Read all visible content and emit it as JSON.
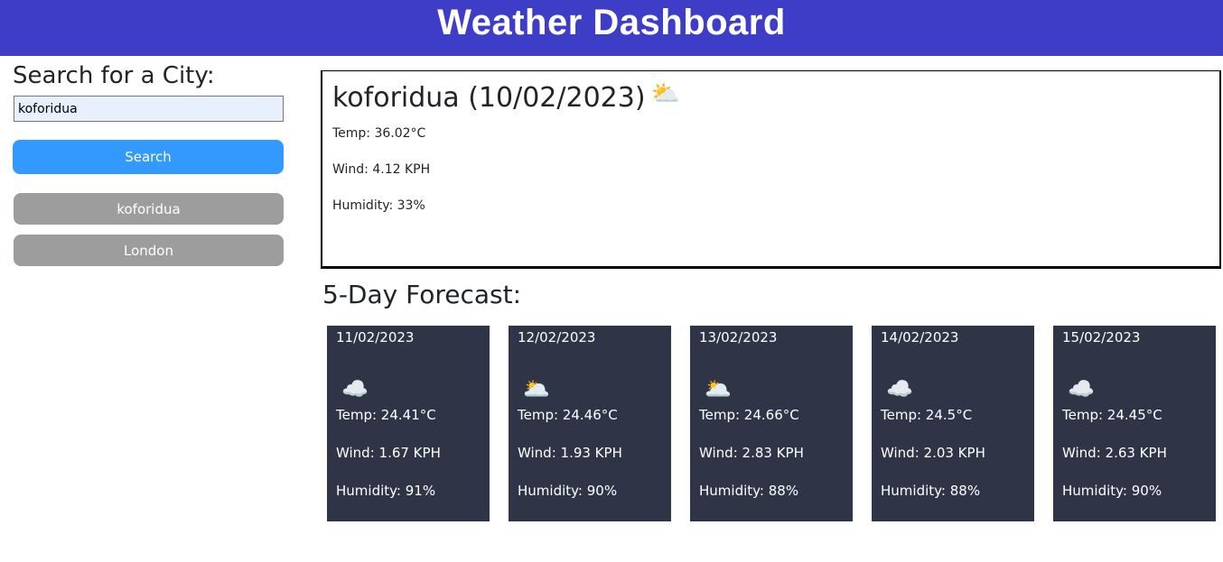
{
  "header": {
    "title": "Weather Dashboard"
  },
  "sidebar": {
    "heading": "Search for a City:",
    "search_value": "koforidua",
    "search_button": "Search",
    "history": [
      "koforidua",
      "London"
    ]
  },
  "current": {
    "title": "koforidua (10/02/2023)",
    "icon": "cloud-sun-icon",
    "temp": "Temp: 36.02°C",
    "wind": "Wind: 4.12 KPH",
    "humidity": "Humidity: 33%"
  },
  "forecast": {
    "heading": "5-Day Forecast:",
    "days": [
      {
        "date": "11/02/2023",
        "icon": "cloud-icon",
        "temp": "Temp: 24.41°C",
        "wind": "Wind: 1.67 KPH",
        "humidity": "Humidity: 91%"
      },
      {
        "date": "12/02/2023",
        "icon": "cloud-dark-icon",
        "temp": "Temp: 24.46°C",
        "wind": "Wind: 1.93 KPH",
        "humidity": "Humidity: 90%"
      },
      {
        "date": "13/02/2023",
        "icon": "cloud-dark-icon",
        "temp": "Temp: 24.66°C",
        "wind": "Wind: 2.83 KPH",
        "humidity": "Humidity: 88%"
      },
      {
        "date": "14/02/2023",
        "icon": "cloud-moon-icon",
        "temp": "Temp: 24.5°C",
        "wind": "Wind: 2.03 KPH",
        "humidity": "Humidity: 88%"
      },
      {
        "date": "15/02/2023",
        "icon": "cloud-moon-icon",
        "temp": "Temp: 24.45°C",
        "wind": "Wind: 2.63 KPH",
        "humidity": "Humidity: 90%"
      }
    ]
  },
  "colors": {
    "header_bg": "#3d3dc7",
    "search_button": "#3399ff",
    "history_button": "#9e9d9e",
    "card_bg": "#2f3547"
  }
}
